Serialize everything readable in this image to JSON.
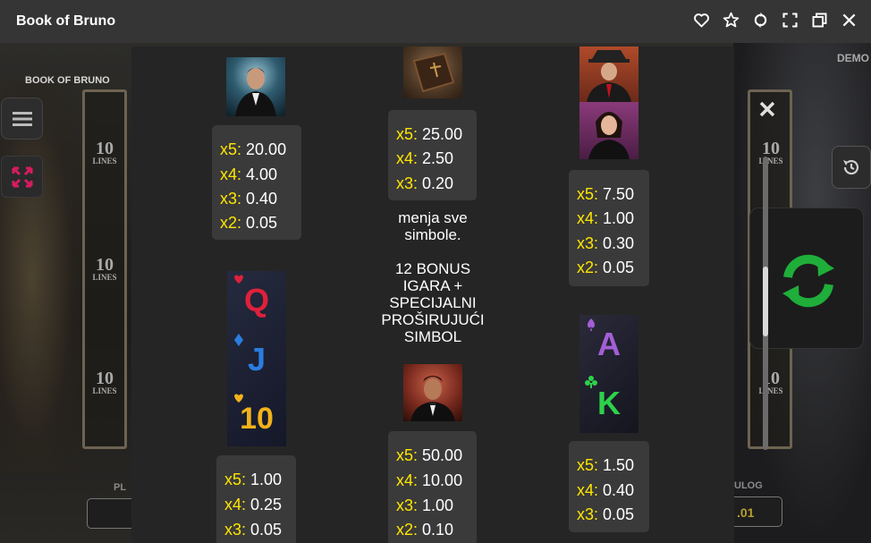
{
  "window": {
    "title": "Book of Bruno"
  },
  "game": {
    "logo": "BOOK OF BRUNO",
    "demo_label": "DEMO",
    "lines": [
      {
        "n": "10",
        "t": "LINES"
      },
      {
        "n": "10",
        "t": "LINES"
      },
      {
        "n": "10",
        "t": "LINES"
      }
    ],
    "left_bottom_label": "PL",
    "right_bottom_label": "ULOG",
    "right_bottom_value": ".01"
  },
  "paytable": {
    "col1_top": [
      {
        "mult": "x5:",
        "value": "20.00"
      },
      {
        "mult": "x4:",
        "value": "4.00"
      },
      {
        "mult": "x3:",
        "value": "0.40"
      },
      {
        "mult": "x2:",
        "value": "0.05"
      }
    ],
    "col2_top": [
      {
        "mult": "x5:",
        "value": "25.00"
      },
      {
        "mult": "x4:",
        "value": "2.50"
      },
      {
        "mult": "x3:",
        "value": "0.20"
      }
    ],
    "col3_top": [
      {
        "mult": "x5:",
        "value": "7.50"
      },
      {
        "mult": "x4:",
        "value": "1.00"
      },
      {
        "mult": "x3:",
        "value": "0.30"
      },
      {
        "mult": "x2:",
        "value": "0.05"
      }
    ],
    "col1_bottom": [
      {
        "mult": "x5:",
        "value": "1.00"
      },
      {
        "mult": "x4:",
        "value": "0.25"
      },
      {
        "mult": "x3:",
        "value": "0.05"
      }
    ],
    "col2_bottom": [
      {
        "mult": "x5:",
        "value": "50.00"
      },
      {
        "mult": "x4:",
        "value": "10.00"
      },
      {
        "mult": "x3:",
        "value": "1.00"
      },
      {
        "mult": "x2:",
        "value": "0.10"
      }
    ],
    "col3_bottom": [
      {
        "mult": "x5:",
        "value": "1.50"
      },
      {
        "mult": "x4:",
        "value": "0.40"
      },
      {
        "mult": "x3:",
        "value": "0.05"
      }
    ],
    "book_desc_1": "menja sve",
    "book_desc_2": "simbole.",
    "bonus_1": "12 BONUS",
    "bonus_2": "IGARA +",
    "bonus_3": "SPECIJALNI",
    "bonus_4": "PROŠIRUJUĆI",
    "bonus_5": "SIMBOL",
    "card_q": "Q",
    "card_j": "J",
    "card_10": "10",
    "card_a": "A",
    "card_k": "K"
  },
  "colors": {
    "multiplier": "#ffe600",
    "spin_green": "#1fae3a",
    "expand_pink": "#d81b60"
  }
}
